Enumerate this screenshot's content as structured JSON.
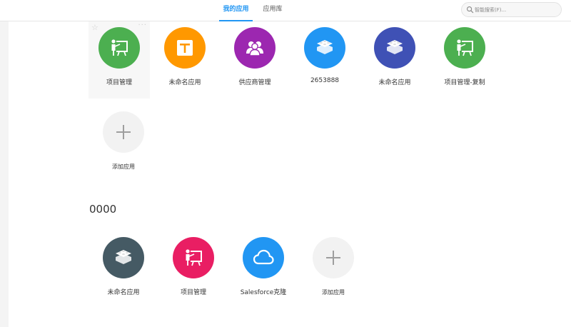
{
  "tabs": {
    "mine": "我的应用",
    "library": "应用库"
  },
  "search": {
    "placeholder": "智能搜索(F)..."
  },
  "group1": {
    "apps": [
      {
        "label": "项目管理",
        "color": "#4caf50",
        "icon": "presentation-icon"
      },
      {
        "label": "未命名应用",
        "color": "#ff9800",
        "icon": "cross-square-icon"
      },
      {
        "label": "供应商管理",
        "color": "#9c27b0",
        "icon": "users-icon"
      },
      {
        "label": "2653888",
        "color": "#2196f3",
        "icon": "layers-icon"
      },
      {
        "label": "未命名应用",
        "color": "#3f51b5",
        "icon": "layers-icon"
      },
      {
        "label": "项目管理-复制",
        "color": "#4caf50",
        "icon": "presentation-icon"
      }
    ],
    "add_label": "添加应用"
  },
  "group2": {
    "title": "0000",
    "apps": [
      {
        "label": "未命名应用",
        "color": "#455a64",
        "icon": "layers-icon"
      },
      {
        "label": "项目管理",
        "color": "#e91e63",
        "icon": "presentation-icon"
      },
      {
        "label": "Salesforce克隆",
        "color": "#2196f3",
        "icon": "cloud-icon"
      }
    ],
    "add_label": "添加应用"
  },
  "colors": {
    "accent": "#2196f3",
    "add_circle": "#f2f2f2",
    "add_plus": "#9e9e9e"
  }
}
